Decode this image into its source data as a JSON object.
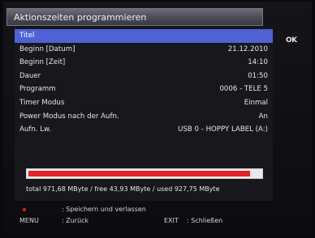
{
  "window": {
    "title": "Aktionszeiten programmieren"
  },
  "side": {
    "ok_label": "OK"
  },
  "rows": [
    {
      "label": "Titel",
      "value": "",
      "selected": true
    },
    {
      "label": "Beginn [Datum]",
      "value": "21.12.2010",
      "selected": false
    },
    {
      "label": "Beginn [Zeit]",
      "value": "14:10",
      "selected": false
    },
    {
      "label": "Dauer",
      "value": "01:50",
      "selected": false
    },
    {
      "label": "Programm",
      "value": "0006 - TELE 5",
      "selected": false
    },
    {
      "label": "Timer Modus",
      "value": "Einmal",
      "selected": false
    },
    {
      "label": "Power Modus nach der Aufn.",
      "value": "An",
      "selected": false
    },
    {
      "label": "Aufn. Lw.",
      "value": "USB 0 - HOPPY LABEL (A:)",
      "selected": false
    }
  ],
  "storage": {
    "used_fraction": 0.955,
    "bar_color": "#e32329",
    "info": "total 971,68 MByte / free 43,93 MByte / used 927,75 MByte"
  },
  "footer": {
    "line1": {
      "key": "●",
      "key_color": "#e02020",
      "desc": ": Speichern und verlassen"
    },
    "line2": {
      "key": "MENU",
      "desc": ": Zurück",
      "key2": "EXIT",
      "desc2": ": Schließen"
    }
  }
}
